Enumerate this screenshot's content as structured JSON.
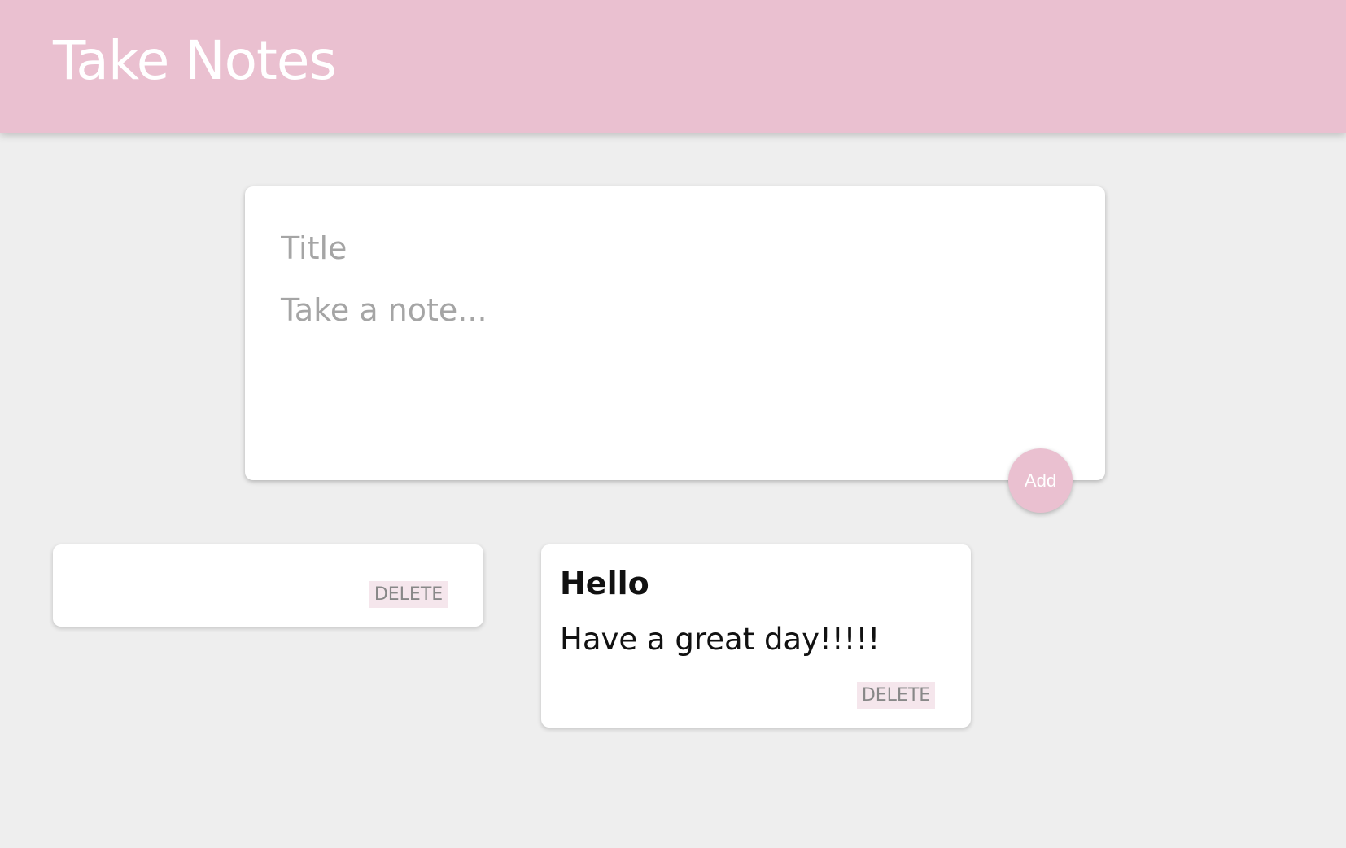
{
  "header": {
    "title": "Take Notes"
  },
  "create_area": {
    "title_placeholder": "Title",
    "content_placeholder": "Take a note...",
    "add_label": "Add"
  },
  "notes": [
    {
      "title": "",
      "content": "",
      "delete_label": "DELETE"
    },
    {
      "title": "Hello",
      "content": "Have a great day!!!!!",
      "delete_label": "DELETE"
    }
  ],
  "colors": {
    "accent": "#eac0d0",
    "background": "#eeeeee",
    "delete_bg": "#f5e6ec"
  }
}
